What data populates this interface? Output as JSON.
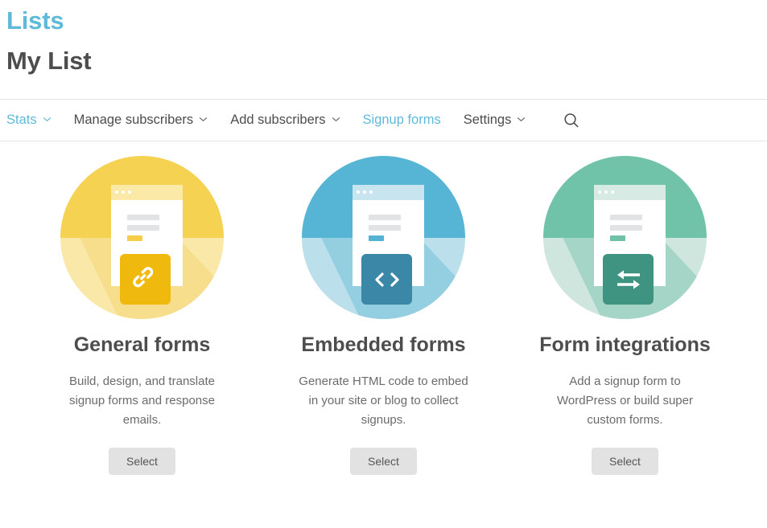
{
  "header": {
    "brand": "Lists",
    "list_name": "My List"
  },
  "nav": {
    "items": [
      {
        "label": "Stats",
        "has_caret": true,
        "accent": true
      },
      {
        "label": "Manage subscribers",
        "has_caret": true,
        "accent": false
      },
      {
        "label": "Add subscribers",
        "has_caret": true,
        "accent": false
      },
      {
        "label": "Signup forms",
        "has_caret": false,
        "accent": true
      },
      {
        "label": "Settings",
        "has_caret": true,
        "accent": false
      }
    ],
    "search_icon": "search-icon"
  },
  "cards": [
    {
      "id": "general-forms",
      "title": "General forms",
      "description": "Build, design, and translate signup forms and response emails.",
      "button_label": "Select",
      "icon": "link-icon",
      "colors": {
        "circle_top": "#F6D253",
        "circle_bottom": "#FAE8A9",
        "shadow": "#F6DE8C",
        "browser_bar": "#FBE9A8",
        "accent_bar": "#F5CE48",
        "icon_square": "#F0B90D"
      }
    },
    {
      "id": "embedded-forms",
      "title": "Embedded forms",
      "description": "Generate HTML code to embed in your site or blog to collect signups.",
      "button_label": "Select",
      "icon": "code-icon",
      "colors": {
        "circle_top": "#56B4D4",
        "circle_bottom": "#BCDFEC",
        "shadow": "#93CEE1",
        "browser_bar": "#C7E4EF",
        "accent_bar": "#54B2D2",
        "icon_square": "#3A87A8"
      }
    },
    {
      "id": "form-integrations",
      "title": "Form integrations",
      "description": "Add a signup form to WordPress or build super custom forms.",
      "button_label": "Select",
      "icon": "exchange-icon",
      "colors": {
        "circle_top": "#70C2A9",
        "circle_bottom": "#CFE6DE",
        "shadow": "#A5D5C6",
        "browser_bar": "#D7EAE3",
        "accent_bar": "#6EC0A7",
        "icon_square": "#3E9480"
      }
    }
  ],
  "theme": {
    "accent": "#5fb9d8",
    "heading": "#4d4d4d",
    "body_text": "#6b6b6b",
    "button_bg": "#e2e2e2"
  }
}
